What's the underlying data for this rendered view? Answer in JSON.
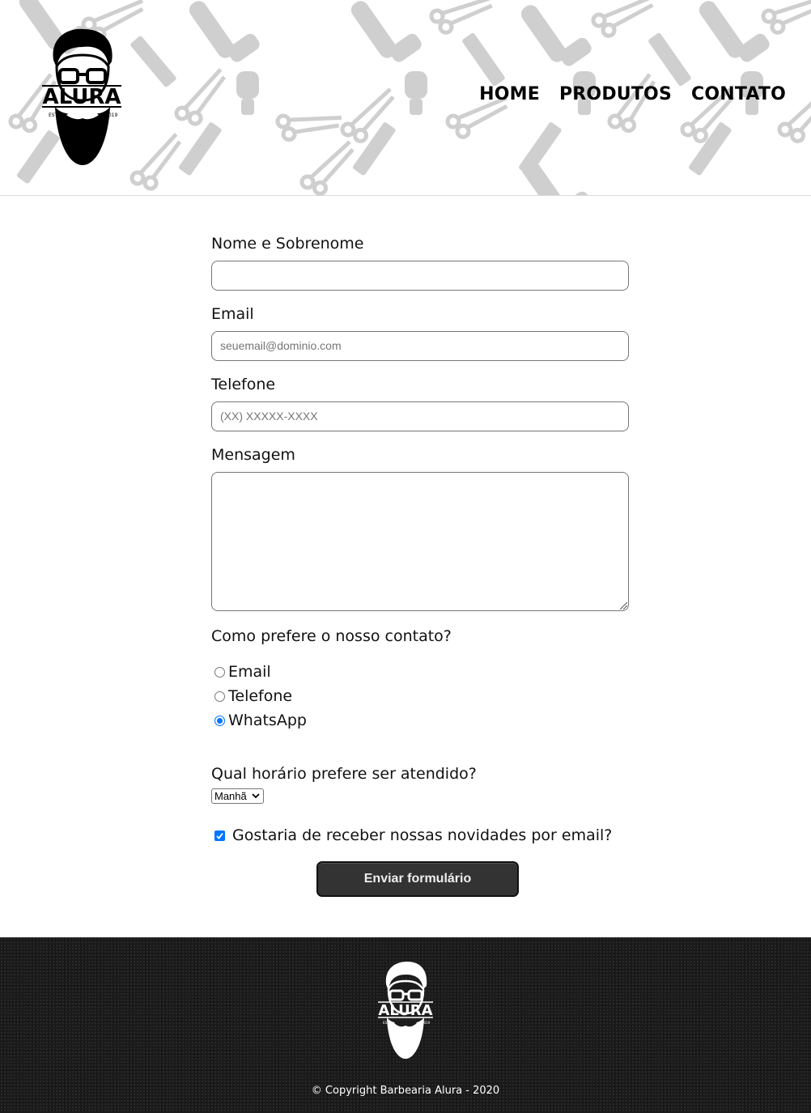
{
  "header": {
    "logo_text": "ALURA",
    "logo_est": "ESTD",
    "logo_year": "2019",
    "nav": [
      "HOME",
      "PRODUTOS",
      "CONTATO"
    ]
  },
  "form": {
    "name_label": "Nome e Sobrenome",
    "name_value": "",
    "email_label": "Email",
    "email_placeholder": "seuemail@dominio.com",
    "phone_label": "Telefone",
    "phone_placeholder": "(XX) XXXXX-XXXX",
    "message_label": "Mensagem",
    "contact_question": "Como prefere o nosso contato?",
    "contact_options": [
      "Email",
      "Telefone",
      "WhatsApp"
    ],
    "contact_selected": "WhatsApp",
    "schedule_question": "Qual horário prefere ser atendido?",
    "schedule_selected": "Manhã",
    "newsletter_label": "Gostaria de receber nossas novidades por email?",
    "newsletter_checked": true,
    "submit_label": "Enviar formulário"
  },
  "footer": {
    "copyright": "© Copyright Barbearia Alura - 2020"
  },
  "colors": {
    "accent": "#0075ff",
    "button_bg": "#333333",
    "footer_bg": "#1b1b1b",
    "pattern": "#cfcfcf"
  }
}
